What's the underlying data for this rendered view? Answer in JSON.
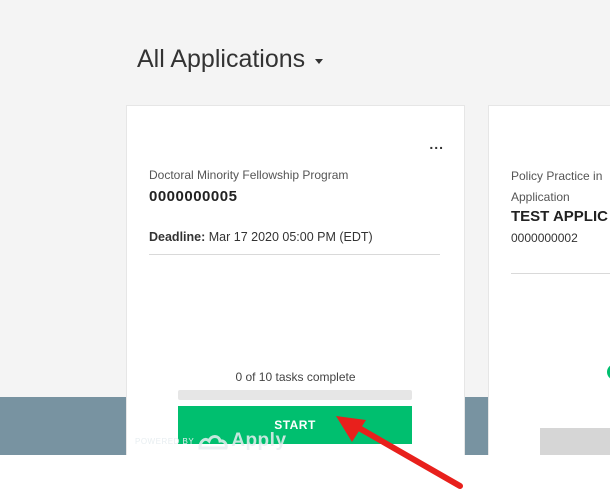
{
  "header": {
    "title": "All Applications"
  },
  "cards": [
    {
      "program": "Doctoral Minority Fellowship Program",
      "number": "0000000005",
      "deadline_label": "Deadline:",
      "deadline_value": "Mar 17 2020 05:00 PM (EDT)",
      "tasks_text": "0 of 10 tasks complete",
      "progress": 0,
      "start_label": "START",
      "menu_label": "..."
    },
    {
      "program_line1": "Policy Practice in",
      "program_line2": "Application",
      "title": "TEST APPLIC",
      "number": "0000000002"
    }
  ],
  "footer": {
    "powered_by": "POWERED BY",
    "brand": "Apply"
  },
  "colors": {
    "accent": "#00bf6f",
    "footer": "#7893a1",
    "arrow": "#e8201c"
  }
}
